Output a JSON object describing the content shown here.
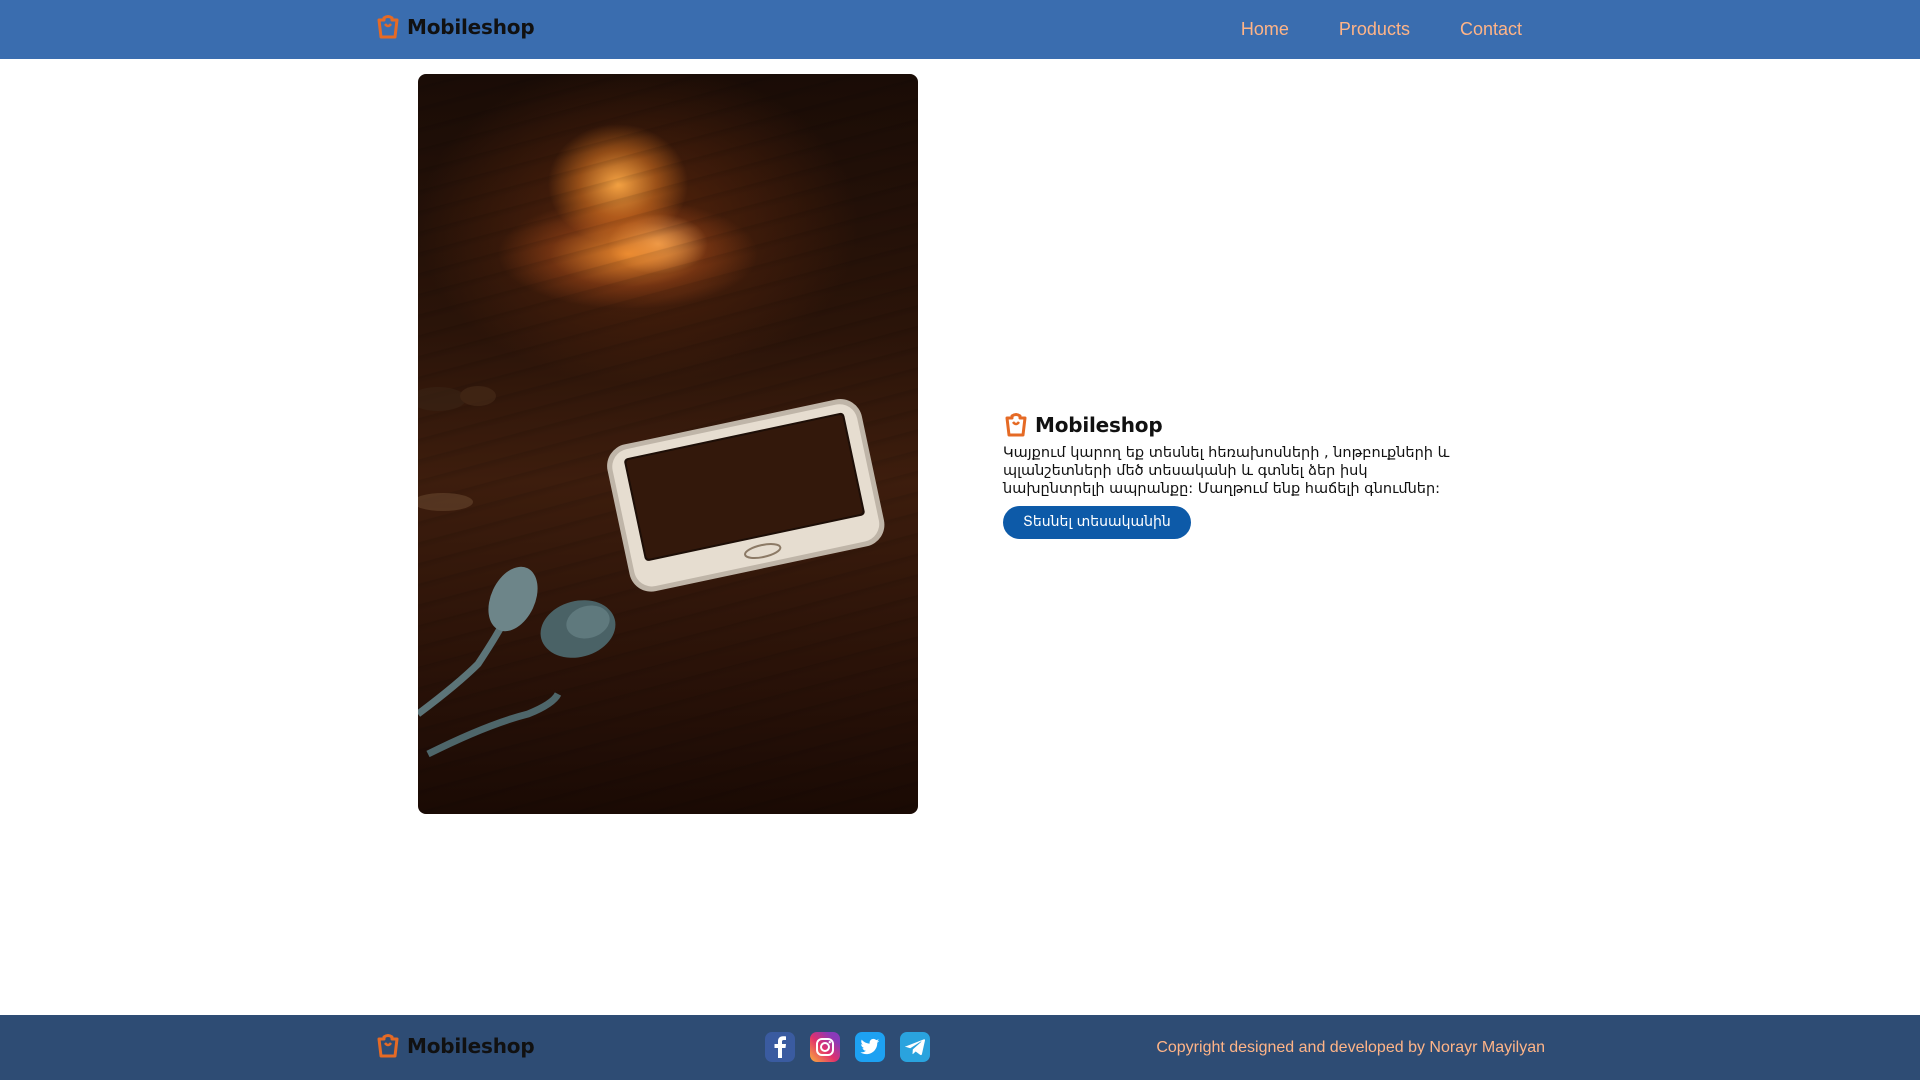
{
  "brand": {
    "name": "Mobileshop",
    "logo_icon": "shopping-bag-icon",
    "accent_color": "#e56a25"
  },
  "header": {
    "background": "#3a6daf",
    "nav": [
      {
        "label": "Home"
      },
      {
        "label": "Products"
      },
      {
        "label": "Contact"
      }
    ],
    "nav_color": "#ffb487"
  },
  "hero": {
    "image_alt_icon": "smartphone-photo",
    "promo": {
      "text": "Կայքում կարող եք տեսնել հեռախոսների , նոթբուքների և պլանշետների մեծ տեսականի և գտնել ձեր իսկ նախընտրելի ապրանքը: Մաղթում ենք հաճելի գնումներ:",
      "button_label": "Տեսնել տեսականին",
      "button_color": "#0d5aa8"
    }
  },
  "footer": {
    "background": "#2e4c74",
    "social": [
      {
        "name": "facebook-icon"
      },
      {
        "name": "instagram-icon"
      },
      {
        "name": "twitter-icon"
      },
      {
        "name": "telegram-icon"
      }
    ],
    "copyright": "Copyright designed and developed by Norayr Mayilyan"
  }
}
